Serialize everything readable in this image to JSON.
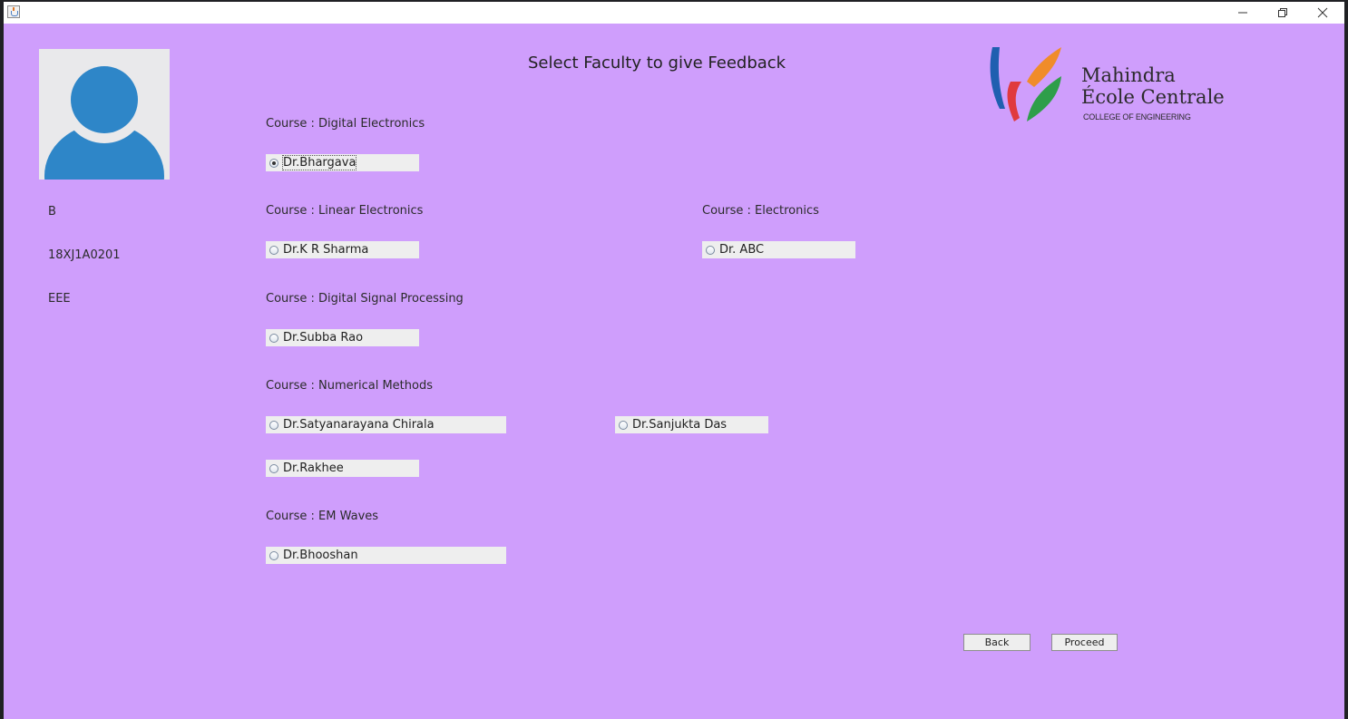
{
  "window": {
    "icon": "java-cup-icon",
    "controls": [
      "minimize-icon",
      "maximize-icon",
      "close-icon"
    ]
  },
  "title": "Select Faculty to give Feedback",
  "student": {
    "name": "B",
    "roll_number": "18XJ1A0201",
    "branch": "EEE"
  },
  "logo": {
    "line1": "Mahindra",
    "line2": "École Centrale",
    "line3": "COLLEGE OF ENGINEERING",
    "colors": [
      "#1f5fb0",
      "#e03a3e",
      "#f08c2a",
      "#2e9e4a"
    ]
  },
  "courses": [
    {
      "label": "Course : Digital Electronics",
      "faculty": [
        {
          "name": "Dr.Bhargava",
          "selected": true
        }
      ]
    },
    {
      "label": "Course : Linear Electronics",
      "faculty": [
        {
          "name": "Dr.K R Sharma",
          "selected": false
        }
      ]
    },
    {
      "label": "Course : Electronics",
      "faculty": [
        {
          "name": "Dr. ABC",
          "selected": false
        }
      ]
    },
    {
      "label": "Course : Digital Signal Processing",
      "faculty": [
        {
          "name": "Dr.Subba Rao",
          "selected": false
        }
      ]
    },
    {
      "label": "Course : Numerical Methods",
      "faculty": [
        {
          "name": "Dr.Satyanarayana Chirala",
          "selected": false
        },
        {
          "name": "Dr.Sanjukta Das",
          "selected": false
        },
        {
          "name": "Dr.Rakhee",
          "selected": false
        }
      ]
    },
    {
      "label": "Course : EM Waves",
      "faculty": [
        {
          "name": "Dr.Bhooshan",
          "selected": false
        }
      ]
    }
  ],
  "buttons": {
    "back": "Back",
    "proceed": "Proceed"
  },
  "colors": {
    "background": "#cf9efc",
    "avatar": "#2e86c8",
    "control": "#eeeeee"
  }
}
